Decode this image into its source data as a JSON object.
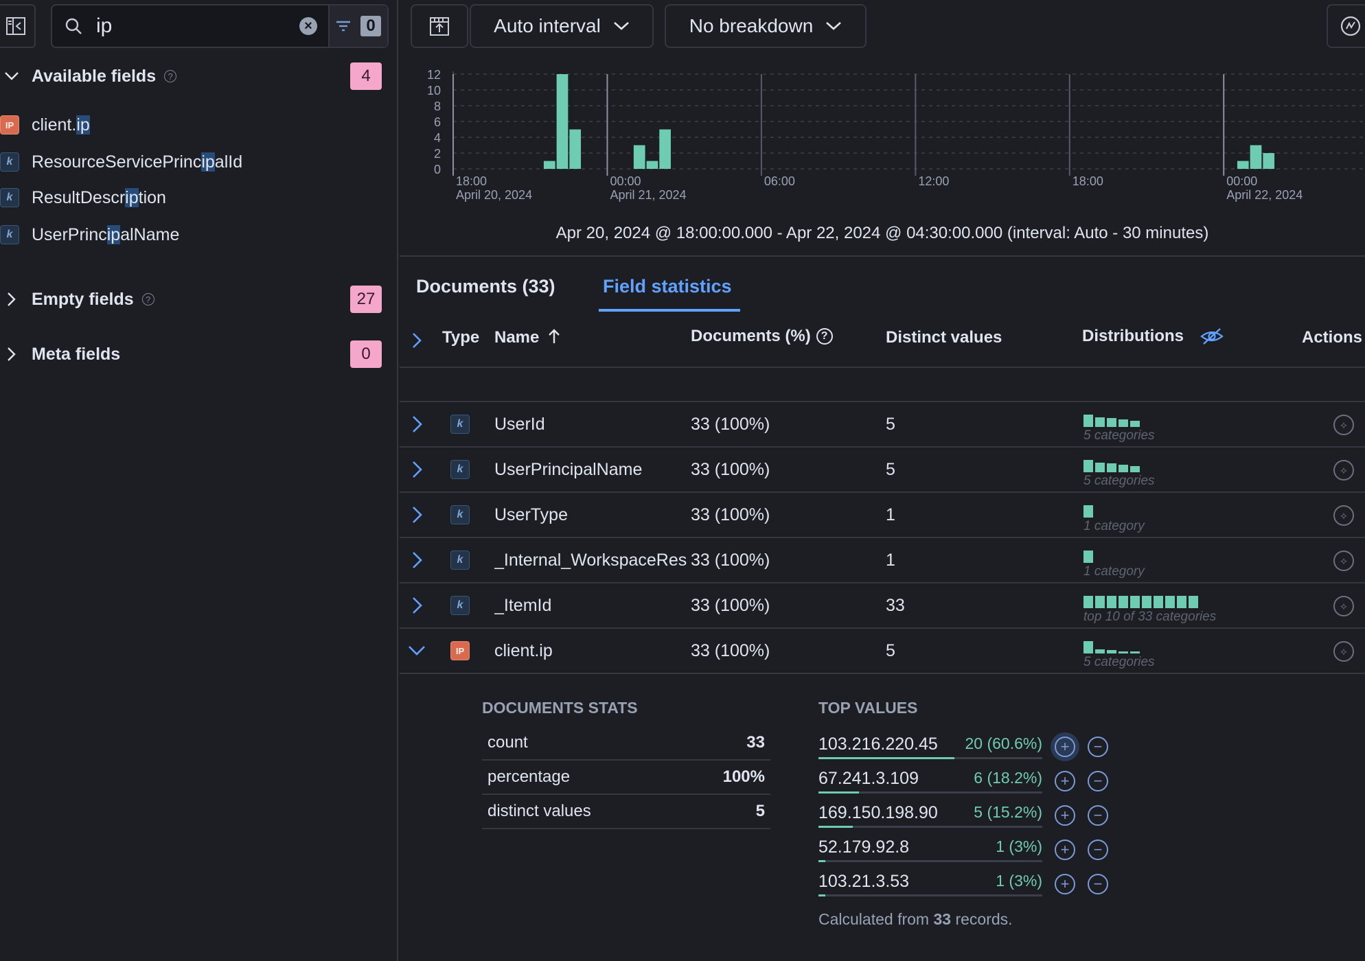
{
  "sidebar": {
    "search": {
      "value": "ip",
      "filter_count": "0"
    },
    "available": {
      "label": "Available fields",
      "count": "4"
    },
    "fields": [
      {
        "pre": "client.",
        "hl": "ip",
        "post": "",
        "type": "ip"
      },
      {
        "pre": "ResourceServicePrinc",
        "hl": "ip",
        "post": "alId",
        "type": "keyword"
      },
      {
        "pre": "ResultDescr",
        "hl": "ip",
        "post": "tion",
        "type": "keyword"
      },
      {
        "pre": "UserPrinc",
        "hl": "ip",
        "post": "alName",
        "type": "keyword"
      }
    ],
    "empty": {
      "label": "Empty fields",
      "count": "27"
    },
    "meta": {
      "label": "Meta fields",
      "count": "0"
    }
  },
  "toolbar": {
    "interval": "Auto interval",
    "breakdown": "No breakdown"
  },
  "chart_data": {
    "type": "bar",
    "y_ticks": [
      "12",
      "10",
      "8",
      "6",
      "4",
      "2",
      "0"
    ],
    "ylim": [
      0,
      12
    ],
    "x_ticks": [
      {
        "time": "18:00",
        "date": "April 20, 2024"
      },
      {
        "time": "00:00",
        "date": "April 21, 2024"
      },
      {
        "time": "06:00",
        "date": ""
      },
      {
        "time": "12:00",
        "date": ""
      },
      {
        "time": "18:00",
        "date": ""
      },
      {
        "time": "00:00",
        "date": "April 22, 2024"
      }
    ],
    "x": [
      "2024-04-20 21:30",
      "2024-04-20 22:00",
      "2024-04-20 22:30",
      "2024-04-21 01:00",
      "2024-04-21 01:30",
      "2024-04-21 02:00",
      "2024-04-22 00:30",
      "2024-04-22 01:00",
      "2024-04-22 01:30"
    ],
    "values": [
      1,
      12,
      5,
      3,
      1,
      5,
      1,
      3,
      2
    ],
    "grid": true,
    "color": "#6dccb1"
  },
  "time_range": "Apr 20, 2024 @ 18:00:00.000 - Apr 22, 2024 @ 04:30:00.000 (interval: Auto - 30 minutes)",
  "tabs": {
    "documents": "Documents (33)",
    "field_statistics": "Field statistics"
  },
  "table": {
    "headers": {
      "type": "Type",
      "name": "Name",
      "documents": "Documents (%)",
      "distinct": "Distinct values",
      "distributions": "Distributions",
      "actions": "Actions"
    },
    "rows": [
      {
        "type": "keyword",
        "name": "UserId",
        "documents": "33 (100%)",
        "distinct": "5",
        "dist_label": "5 categories",
        "dist": [
          1,
          0.8,
          0.7,
          0.6,
          0.5
        ]
      },
      {
        "type": "keyword",
        "name": "UserPrincipalName",
        "documents": "33 (100%)",
        "distinct": "5",
        "dist_label": "5 categories",
        "dist": [
          1,
          0.8,
          0.7,
          0.6,
          0.5
        ]
      },
      {
        "type": "keyword",
        "name": "UserType",
        "documents": "33 (100%)",
        "distinct": "1",
        "dist_label": "1 category",
        "dist": [
          1
        ]
      },
      {
        "type": "keyword",
        "name": "_Internal_WorkspaceRes",
        "documents": "33 (100%)",
        "distinct": "1",
        "dist_label": "1 category",
        "dist": [
          1
        ]
      },
      {
        "type": "keyword",
        "name": "_ItemId",
        "documents": "33 (100%)",
        "distinct": "33",
        "dist_label": "top 10 of 33 categories",
        "dist": [
          1,
          1,
          1,
          1,
          1,
          1,
          1,
          1,
          1,
          1
        ]
      },
      {
        "type": "ip",
        "name": "client.ip",
        "documents": "33 (100%)",
        "distinct": "5",
        "dist_label": "5 categories",
        "dist": [
          1,
          0.35,
          0.3,
          0.1,
          0.1
        ]
      }
    ]
  },
  "details": {
    "documents_stats_title": "DOCUMENTS STATS",
    "stats": [
      {
        "label": "count",
        "value": "33"
      },
      {
        "label": "percentage",
        "value": "100%"
      },
      {
        "label": "distinct values",
        "value": "5"
      }
    ],
    "top_values_title": "TOP VALUES",
    "top_values": [
      {
        "value": "103.216.220.45",
        "count": "20 (60.6%)",
        "fraction": 0.606
      },
      {
        "value": "67.241.3.109",
        "count": "6 (18.2%)",
        "fraction": 0.182
      },
      {
        "value": "169.150.198.90",
        "count": "5 (15.2%)",
        "fraction": 0.152
      },
      {
        "value": "52.179.92.8",
        "count": "1 (3%)",
        "fraction": 0.03
      },
      {
        "value": "103.21.3.53",
        "count": "1 (3%)",
        "fraction": 0.03
      }
    ],
    "calc_prefix": "Calculated from ",
    "calc_count": "33",
    "calc_suffix": " records."
  }
}
